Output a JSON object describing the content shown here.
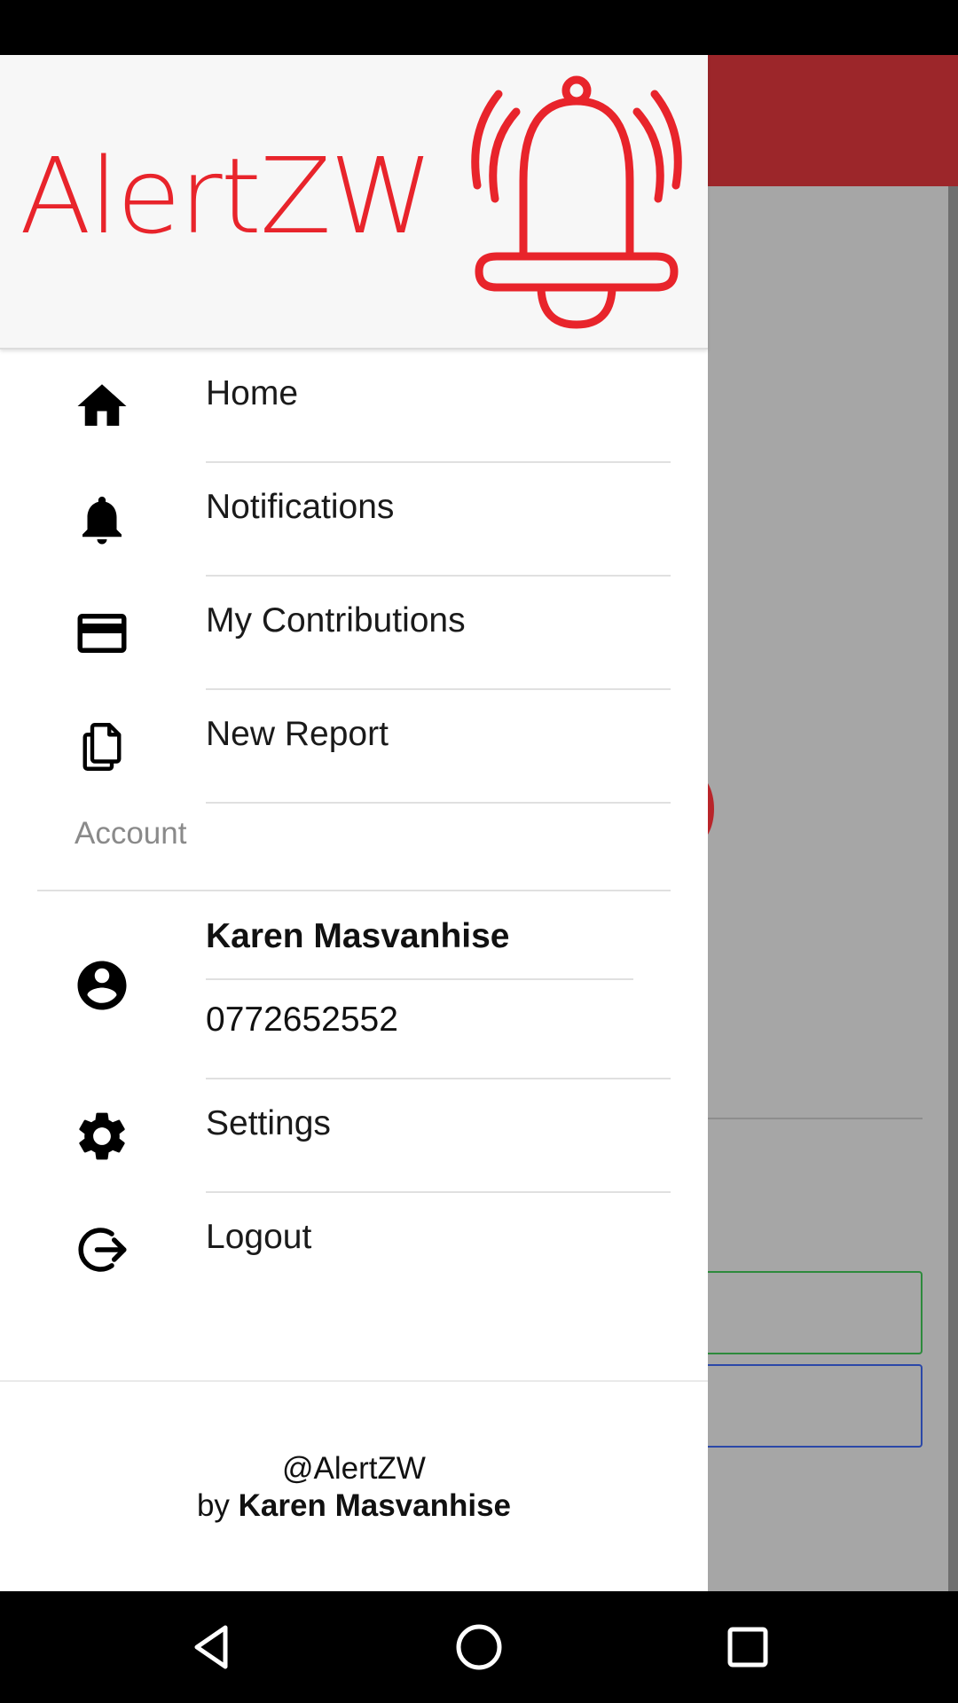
{
  "app": {
    "brand": "AlertZW",
    "colors": {
      "brand_red": "#e8242b",
      "appbar": "#9c262a"
    }
  },
  "drawer": {
    "menu": [
      {
        "label": "Home",
        "icon": "home-icon"
      },
      {
        "label": "Notifications",
        "icon": "bell-icon"
      },
      {
        "label": "My Contributions",
        "icon": "credit-card-icon"
      },
      {
        "label": "New Report",
        "icon": "documents-icon"
      }
    ],
    "account_section": {
      "title": "Account",
      "name": "Karen Masvanhise",
      "phone": "0772652552",
      "icon": "account-circle-icon"
    },
    "settings": {
      "label": "Settings",
      "icon": "gear-icon"
    },
    "logout": {
      "label": "Logout",
      "icon": "logout-icon"
    },
    "footer": {
      "handle": "@AlertZW",
      "by_prefix": "by",
      "author": "Karen Masvanhise"
    }
  },
  "system_nav": {
    "back": "back-icon",
    "home": "home-circle-icon",
    "recents": "recents-icon"
  }
}
